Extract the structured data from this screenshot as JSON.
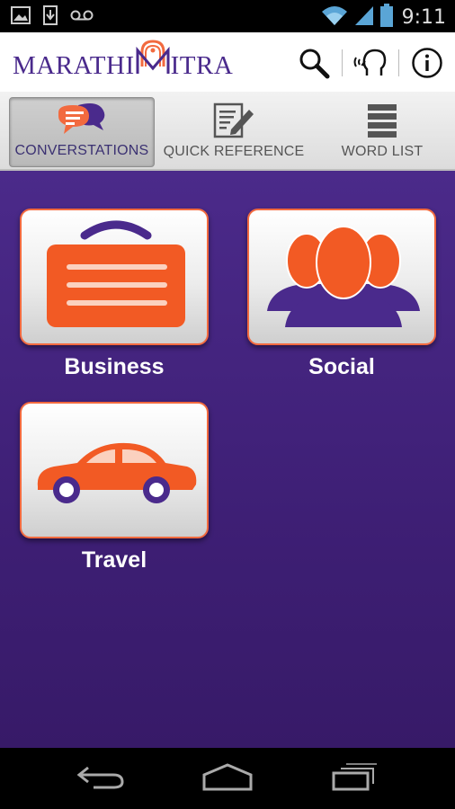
{
  "status_bar": {
    "time": "9:11",
    "icons": [
      "image-icon",
      "download-icon",
      "voicemail-icon",
      "wifi-icon",
      "signal-icon",
      "battery-icon"
    ]
  },
  "app": {
    "logo_left": "MARATHI",
    "logo_right": "ITRA",
    "brand_color": "#4a2a8c",
    "accent_color": "#f26a3f"
  },
  "header_actions": [
    {
      "name": "search",
      "icon": "search-icon"
    },
    {
      "name": "speak",
      "icon": "speaking-head-icon"
    },
    {
      "name": "info",
      "icon": "info-icon"
    }
  ],
  "tabs": [
    {
      "label": "CONVERSTATIONS",
      "icon": "chat-bubbles-icon",
      "active": true
    },
    {
      "label": "QUICK REFERENCE",
      "icon": "notepad-pencil-icon",
      "active": false
    },
    {
      "label": "WORD LIST",
      "icon": "list-stack-icon",
      "active": false
    }
  ],
  "categories": [
    {
      "label": "Business",
      "icon": "briefcase-icon"
    },
    {
      "label": "Social",
      "icon": "people-group-icon"
    },
    {
      "label": "Travel",
      "icon": "car-icon"
    }
  ],
  "nav": [
    "back-icon",
    "home-icon",
    "recent-apps-icon"
  ]
}
